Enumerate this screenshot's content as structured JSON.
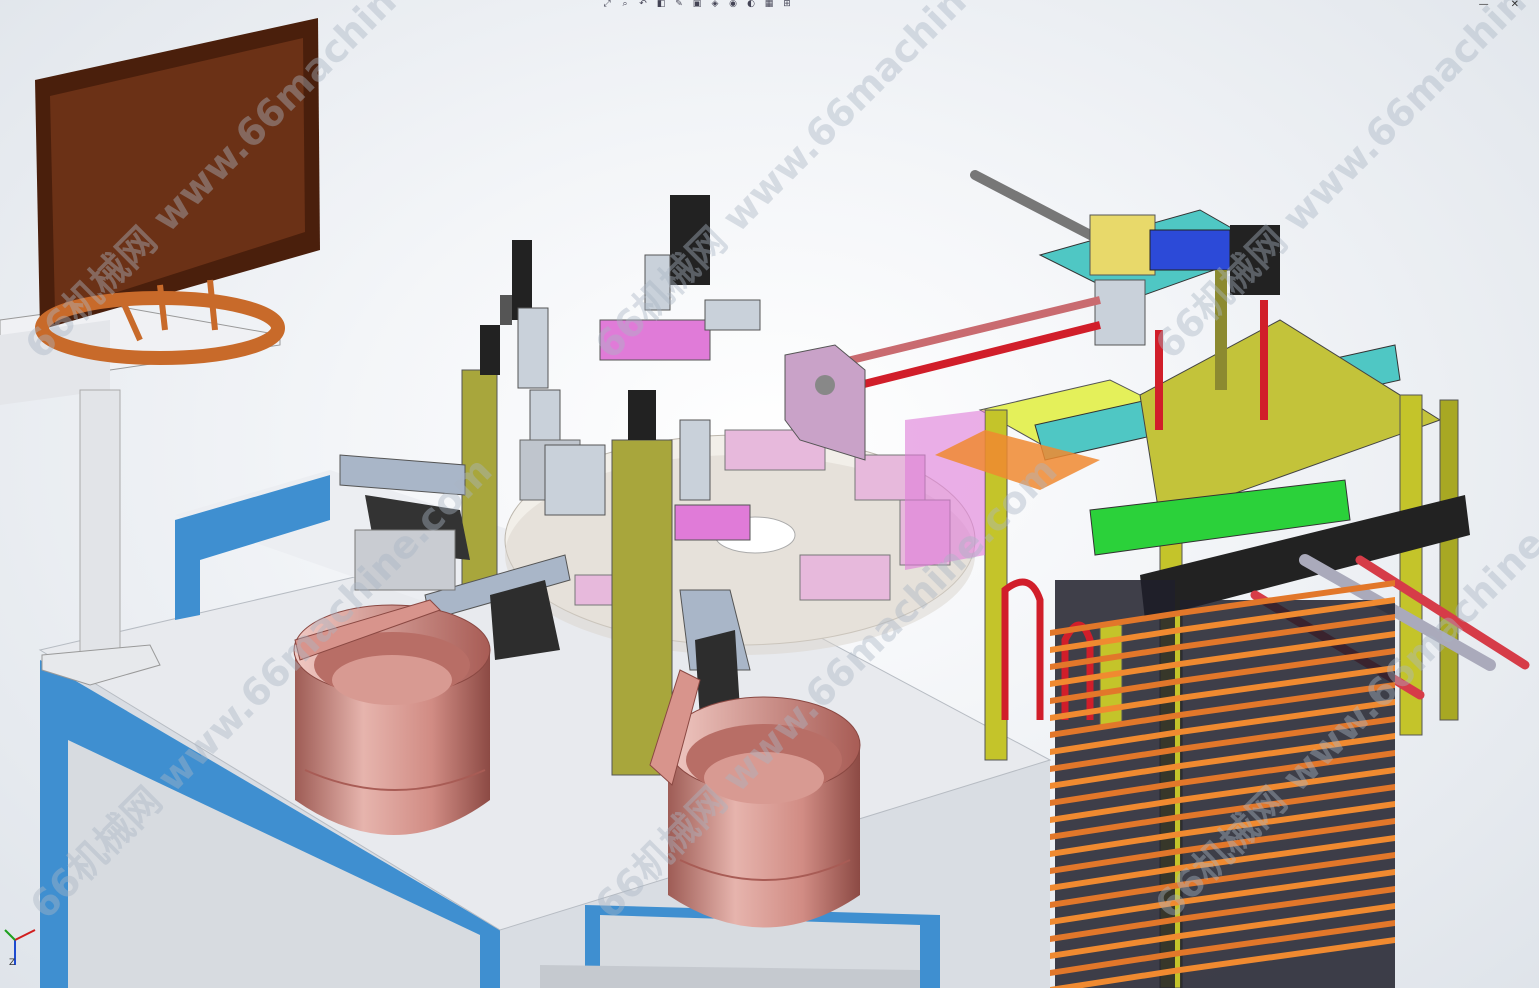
{
  "watermark": {
    "text": "66机械网 www.66machine.com"
  },
  "toolbar": {
    "icons": [
      "zoom-fit-icon",
      "zoom-area-icon",
      "previous-view-icon",
      "section-view-icon",
      "dynamic-annotation-icon",
      "view-orientation-icon",
      "display-style-icon",
      "hide-show-icon",
      "edit-appearance-icon",
      "apply-scene-icon",
      "view-settings-icon"
    ]
  },
  "window_controls": {
    "minimize": "—",
    "close": "✕"
  },
  "triad": {
    "axis_label": "Z"
  },
  "colors": {
    "frame_blue": "#3f8fd0",
    "table_top": "#e6e8ec",
    "copper_bowl": "#c8837a",
    "yellow_frame": "#d6d31c",
    "orange_tray": "#f08a30",
    "monitor_brown": "#5a2a14",
    "purple_part": "#c79ad8",
    "cyan_plate": "#4fc7c4"
  }
}
